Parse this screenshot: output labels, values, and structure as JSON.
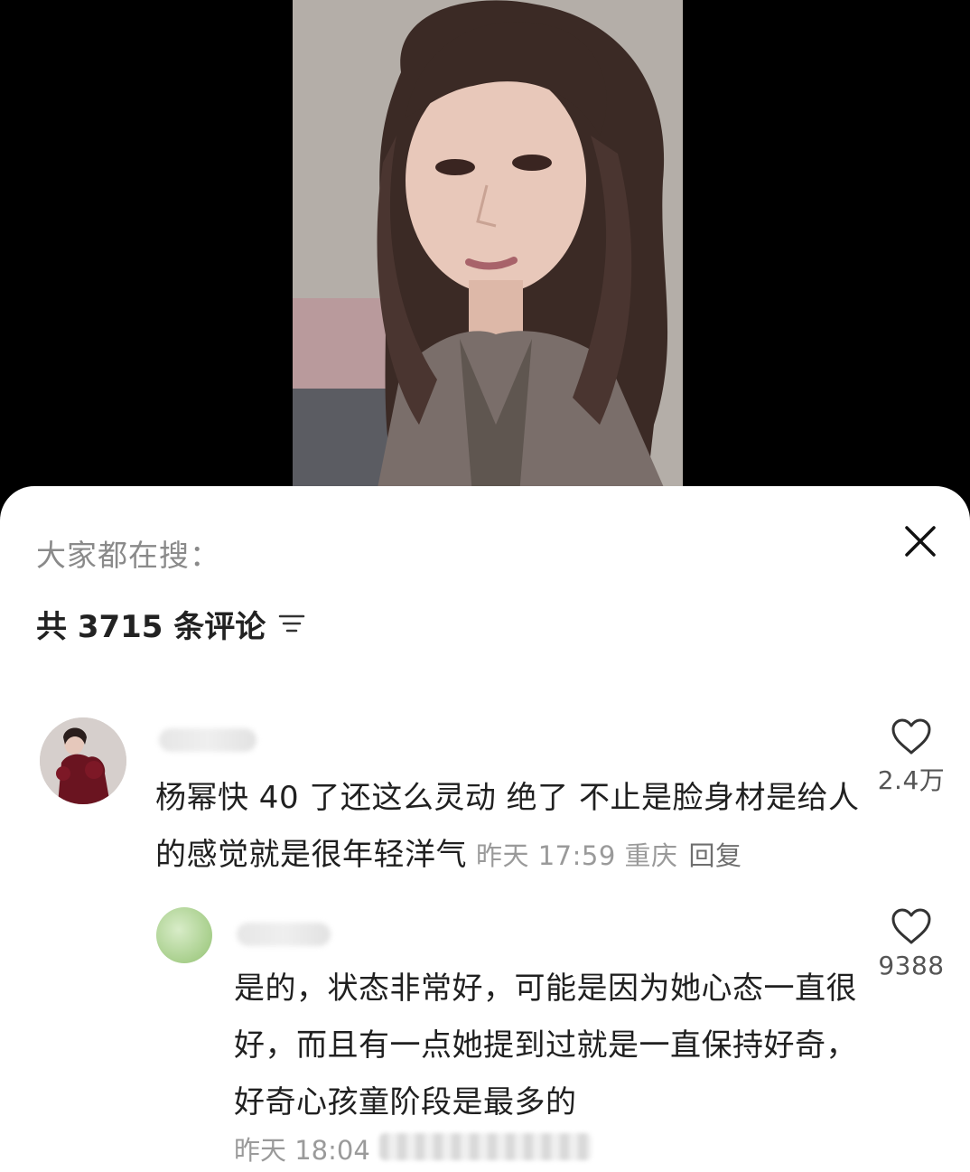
{
  "video": {
    "thumbnail": "portrait-photo"
  },
  "sheet": {
    "search_hint": "大家都在搜：",
    "comment_count_label": "共 3715 条评论",
    "close_icon": "close-icon",
    "filter_icon": "sort-filter-icon"
  },
  "comments": [
    {
      "text": "杨幂快 40 了还这么灵动 绝了 不止是脸身材是给人的感觉就是很年轻洋气",
      "time_location": "昨天 17:59 重庆",
      "reply_label": "回复",
      "like_count": "2.4万"
    },
    {
      "text": "是的，状态非常好，可能是因为她心态一直很好，而且有一点她提到过就是一直保持好奇，好奇心孩童阶段是最多的",
      "time_location": "昨天 18:04",
      "like_count": "9388"
    }
  ],
  "colors": {
    "background": "#000000",
    "sheet": "#ffffff",
    "primary_text": "#202020",
    "secondary_text": "#9a9a9a"
  }
}
